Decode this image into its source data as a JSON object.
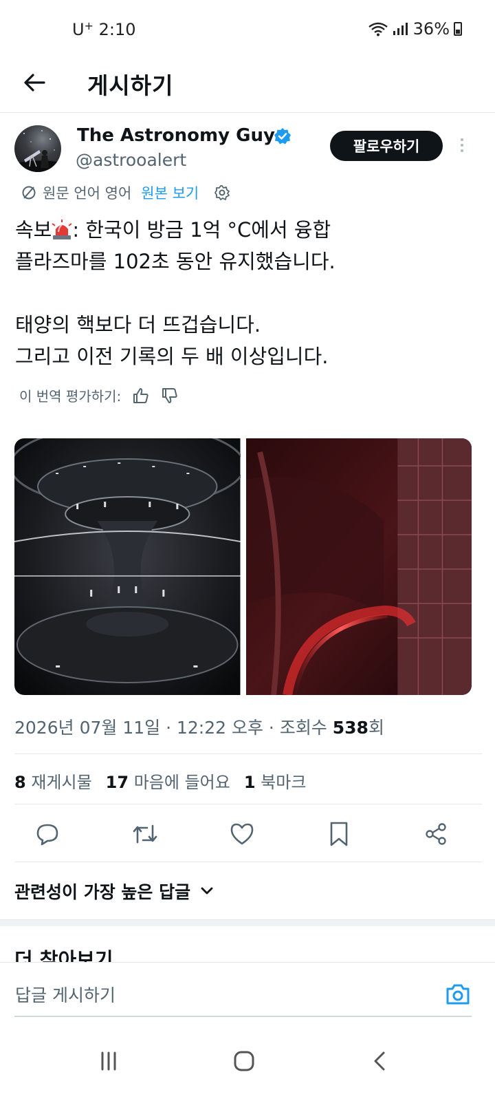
{
  "status_bar": {
    "carrier": "U",
    "carrier_sup": "+",
    "time": "2:10",
    "battery": "36%"
  },
  "header": {
    "title": "게시하기",
    "back_icon": "arrow-left-icon"
  },
  "post": {
    "author": {
      "display_name": "The Astronomy Guy",
      "handle": "@astrooalert",
      "verified": true
    },
    "follow_label": "팔로우하기",
    "translation": {
      "notice": "원문 언어 영어",
      "show_original": "원본 보기"
    },
    "text_prefix": "속보",
    "text_main": ": 한국이 방금 1억 °C에서 융합\n플라즈마를 102초 동안 유지했습니다.\n\n태양의 핵보다 더 뜨겁습니다.\n그리고 이전 기록의 두 배 이상입니다.",
    "rate_translation": "이 번역 평가하기:",
    "images": [
      "fusion-reactor-dark-render",
      "tokamak-red-plasma"
    ],
    "timestamp": "2026년 07월 11일 · 12:22 오후 · 조회수 ",
    "views": "538",
    "views_suffix": "회",
    "stats": {
      "reposts_count": "8",
      "reposts_label": "재게시물",
      "likes_count": "17",
      "likes_label": "마음에 들어요",
      "bookmarks_count": "1",
      "bookmarks_label": "북마크"
    }
  },
  "actions": [
    "reply-icon",
    "repost-icon",
    "like-icon",
    "bookmark-icon",
    "share-icon"
  ],
  "replies": {
    "sort_label": "관련성이 가장 높은 답글"
  },
  "more_section": {
    "title": "더 찾아보기"
  },
  "reply_bar": {
    "placeholder": "답글 게시하기"
  },
  "colors": {
    "accent": "#1d9bf0",
    "text": "#0f1419",
    "secondary": "#536471"
  }
}
